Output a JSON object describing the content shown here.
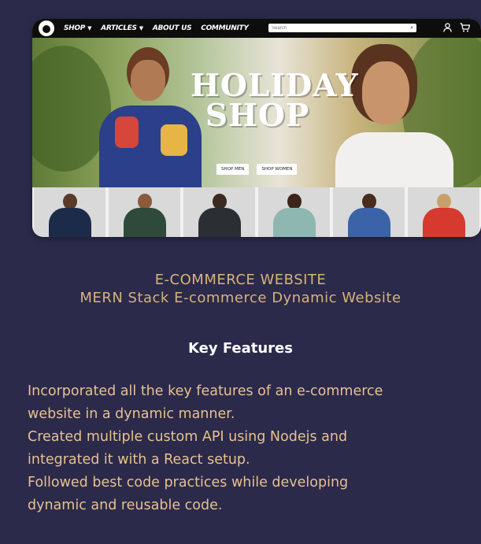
{
  "nav": {
    "items": [
      {
        "label": "SHOP",
        "has_caret": true
      },
      {
        "label": "ARTICLES",
        "has_caret": true
      },
      {
        "label": "ABOUT US",
        "has_caret": false
      },
      {
        "label": "COMMUNITY",
        "has_caret": false
      }
    ],
    "search_placeholder": "Search",
    "search_icon": "search-icon",
    "user_icon": "user-icon",
    "cart_icon": "cart-icon"
  },
  "banner": {
    "title_line1": "HOLIDAY",
    "title_line2": "SHOP",
    "btn_men": "SHOP MEN",
    "btn_women": "SHOP WOMEN"
  },
  "heading": {
    "line1": "E-COMMERCE WEBSITE",
    "line2": "MERN Stack E-commerce Dynamic Website"
  },
  "key_features_title": "Key Features",
  "features": [
    "Incorporated all the key features of an e-commerce",
    "website in a dynamic manner.",
    "Created multiple custom API using Nodejs and",
    "integrated it with a React setup.",
    "Followed best code practices while developing",
    "dynamic and reusable code."
  ]
}
